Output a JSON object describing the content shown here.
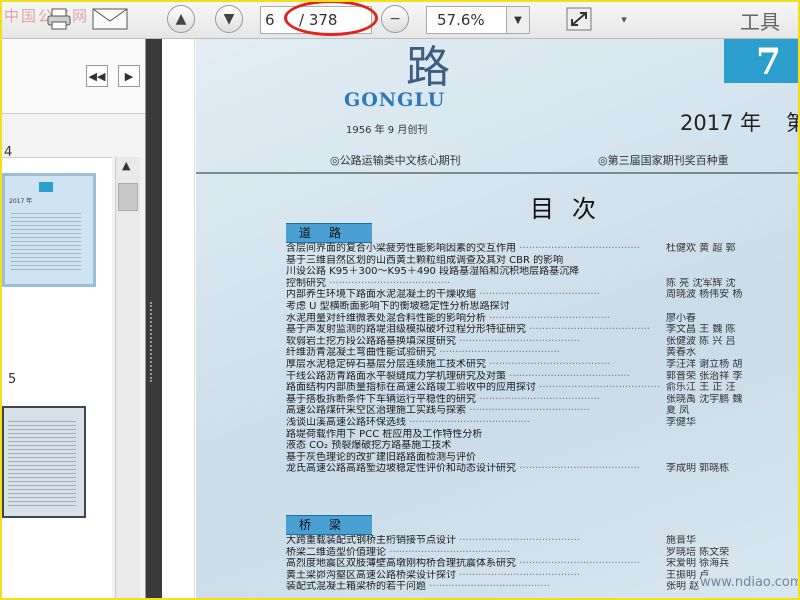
{
  "watermark": "中国公路网",
  "toolbar": {
    "page_current": "6",
    "page_total": "/ 378",
    "zoom": "57.6%",
    "tools_label": "工具",
    "icons": [
      "mail-icon",
      "print-icon",
      "prev-page-icon",
      "next-page-icon",
      "zoom-out-icon",
      "zoom-dropdown-icon",
      "fullscreen-icon",
      "toolbar-menu-icon"
    ]
  },
  "left_panel": {
    "thumb_page_label_top": "4",
    "thumb_page_label_bottom": "5",
    "thumb_year": "2017 年"
  },
  "document": {
    "title_brush": "路",
    "gonglu": "GONGLU",
    "issue_number": "7",
    "founded": "1956 年 9 月创刊",
    "year": "2017 年",
    "year_tail": "第",
    "core_journal": "◎公路运输类中文核心期刊",
    "award": "◎第三届国家期刊奖百种重",
    "contents_title": "目次",
    "sections": [
      {
        "title": "道路",
        "items": [
          {
            "text": "含层间界面的复合小梁疲劳性能影响因素的交互作用",
            "authors": "杜健欢 黄 超 郭"
          },
          {
            "text": "基于三维自然区划的山西黄土颗粒组成调查及其对 CBR 的影响",
            "authors": ""
          },
          {
            "text": "川设公路 K95＋300～K95＋490 段路基湿陷和沉积地层路基沉降",
            "authors": ""
          },
          {
            "text": "控制研究",
            "authors": "陈 亮 沈军辉 沈"
          },
          {
            "text": "内部养生环境下路面水泥混凝土的干燥收缩",
            "authors": "周晓波 杨伟安 杨"
          },
          {
            "text": "考虑 U 型横断面影响下的衡坡稳定性分析思路探讨",
            "authors": ""
          },
          {
            "text": "水泥用量对纤维微表处混合料性能的影响分析",
            "authors": "廖小春"
          },
          {
            "text": "基于声发射监测的路堤泪级模拟破坏过程分形特征研究",
            "authors": "李文昌 王 魏 陈"
          },
          {
            "text": "软弱岩土挖方段公路路基换填深度研究",
            "authors": "张健波 陈 兴 吕"
          },
          {
            "text": "纤维沥青混凝土弯曲性能试验研究",
            "authors": "黄春水"
          },
          {
            "text": "厚层水泥稳定碎石基层分层连续施工技术研究",
            "authors": "李汪洋 谢立杨 胡"
          },
          {
            "text": "干线公路沥青路面水平裂缝成力学机理研究及对策",
            "authors": "郭普荣 张治祥 李"
          },
          {
            "text": "路面结构内部质量指标在高速公路竣工验收中的应用探讨",
            "authors": "俞乐江 王 正 汪"
          },
          {
            "text": "基于搭板拆断条件下车辆运行平稳性的研究",
            "authors": "张晓禹 沈宇鹏 魏"
          },
          {
            "text": "高速公路煤矸采空区治理施工实践与探索",
            "authors": "夏 凤"
          },
          {
            "text": "浅谈山溪高速公路环保选线",
            "authors": "李健华"
          },
          {
            "text": "路堤荷载作用下 PCC 桩应用及工作特性分析",
            "authors": ""
          },
          {
            "text": "液态 CO₂ 预裂爆破挖方路基施工技术",
            "authors": ""
          },
          {
            "text": "基于灰色理论的改扩建旧路路面检测与评价",
            "authors": ""
          },
          {
            "text": "龙氏高速公路高路堑边坡稳定性评价和动态设计研究",
            "authors": "李成明 郭晓栋"
          }
        ]
      },
      {
        "title": "桥梁",
        "items": [
          {
            "text": "大跨重载装配式钢桥主桁销接节点设计",
            "authors": "施晋华"
          },
          {
            "text": "桥梁二维造型价值理论",
            "authors": "罗晓培 陈文荣"
          },
          {
            "text": "高烈度地震区双肢薄壁高墩刚构桥合理抗震体系研究",
            "authors": "宋爱明 徐海兵"
          },
          {
            "text": "黄土梁峁沟壑区高速公路桥梁设计探讨",
            "authors": "王振明 卢"
          },
          {
            "text": "装配式混凝土箱梁桥的若干问题",
            "authors": "张明 赵"
          }
        ]
      }
    ],
    "site": "www.ndiao.com"
  }
}
